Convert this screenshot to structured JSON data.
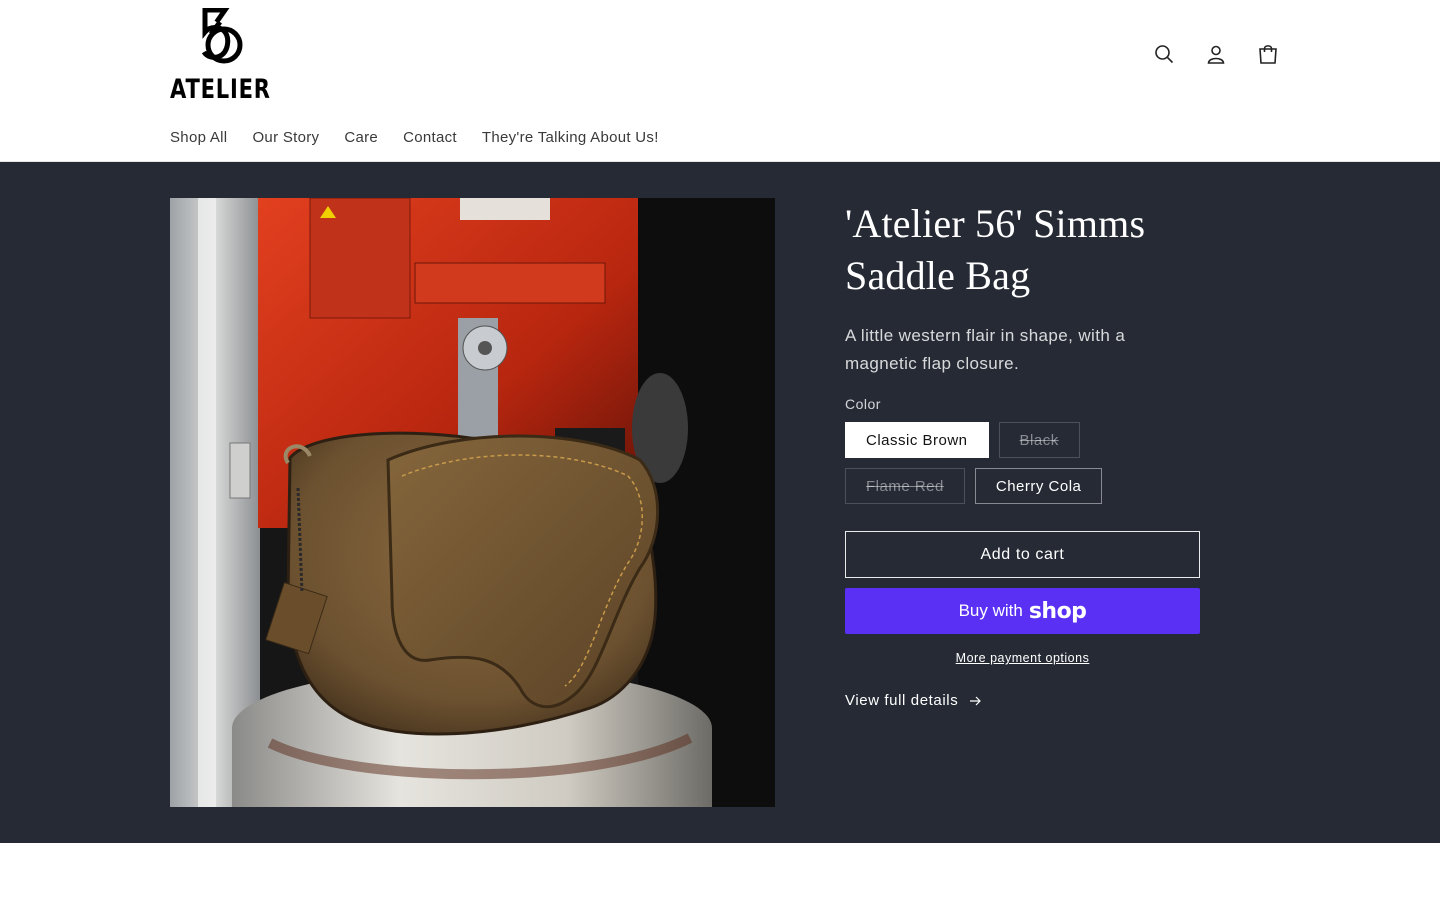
{
  "brand": {
    "logo_text": "ATELIER",
    "logo_mark": "56 monogram"
  },
  "header": {
    "icons": [
      "search-icon",
      "account-icon",
      "cart-icon"
    ]
  },
  "nav": {
    "items": [
      "Shop All",
      "Our Story",
      "Care",
      "Contact",
      "They're Talking About Us!"
    ]
  },
  "product": {
    "title": "'Atelier 56' Simms Saddle Bag",
    "description": "A little western flair in shape, with a magnetic flap closure.",
    "image_alt": "Brown leather saddle bag on a metal stand in front of a red machine",
    "option_label": "Color",
    "swatches": [
      {
        "label": "Classic Brown",
        "state": "selected"
      },
      {
        "label": "Black",
        "state": "unavailable"
      },
      {
        "label": "Flame Red",
        "state": "unavailable"
      },
      {
        "label": "Cherry Cola",
        "state": "available"
      }
    ],
    "add_to_cart": "Add to cart",
    "buy_with": "Buy with",
    "buy_brand": "shop",
    "more_payment": "More payment options",
    "view_full": "View full details",
    "view_full_icon": "arrow-right-icon"
  },
  "colors": {
    "section_bg": "#252a35",
    "shop_pay": "#5a31f4",
    "header_bg": "#ffffff"
  }
}
